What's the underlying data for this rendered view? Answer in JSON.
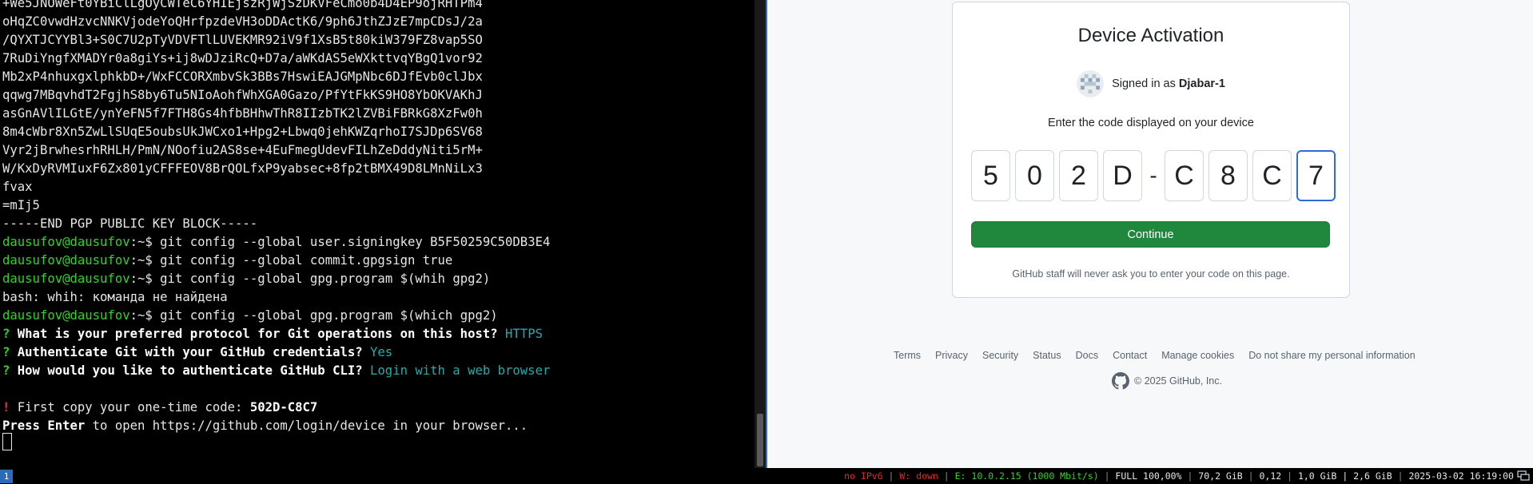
{
  "terminal": {
    "key_lines": [
      "+We5JNOWeFt0YBiClLgOyCWTeC6YHIEjszRjWjSzDKVFeCmo0b4D4EP9ojRHTPm4",
      "oHqZC0vwdHzvcNNKVjodeYoQHrfpzdeVH3oDDActK6/9ph6JthZJzE7mpCDsJ/2a",
      "/QYXTJCYYBl3+S0C7U2pTyVDVFTlLUVEKMR92iV9f1XsB5t80kiW379FZ8vap5SO",
      "7RuDiYngfXMADYr0a8giYs+ij8wDJziRcQ+D7a/aWKdAS5eWXkttvqYBgQ1vor92",
      "Mb2xP4nhuxgxlphkbD+/WxFCCORXmbvSk3BBs7HswiEAJGMpNbc6DJfEvb0clJbx",
      "qqwg7MBqvhdT2FgjhS8by6Tu5NIoAohfWhXGA0Gazo/PfYtFkKS9HO8YbOKVAKhJ",
      "asGnAVlILGtE/ynYeFN5f7FTH8Gs4hfbBHhwThR8IIzbTK2lZVBiFBRkG8XzFw0h",
      "8m4cWbr8Xn5ZwLlSUqE5oubsUkJWCxo1+Hpg2+Lbwq0jehKWZqrhoI7SJDp6SV68",
      "Vyr2jBrwhesrhRHLH/PmN/NOofiu2AS8se+4EuFmegUdevFILhZeDddyNiti5rM+",
      "W/KxDyRVMIuxF6Zx801yCFFFEOV8BrQOLfxP9yabsec+8fp2tBMX49D8LMnNiLx3",
      "fvax",
      "=mIj5",
      "-----END PGP PUBLIC KEY BLOCK-----"
    ],
    "prompt_user": "dausufov@dausufov",
    "prompt_suffix": ":~$ ",
    "cmd1": "git config --global user.signingkey B5F50259C50DB3E4",
    "cmd2": "git config --global commit.gpgsign true",
    "cmd3": "git config --global gpg.program $(whih gpg2)",
    "error_line": "bash: whih: команда не найдена",
    "cmd4": "git config --global gpg.program $(which gpg2)",
    "q_mark": "? ",
    "q1": "What is your preferred protocol for Git operations on this host? ",
    "a1": "HTTPS",
    "q2": "Authenticate Git with your GitHub credentials? ",
    "a2": "Yes",
    "q3": "How would you like to authenticate GitHub CLI? ",
    "a3": "Login with a web browser",
    "bang": "! ",
    "copy_text": "First copy your one-time code: ",
    "one_time_code": "502D-C8C7",
    "press_enter": "Press Enter",
    "open_text": " to open https://github.com/login/device in your browser..."
  },
  "browser": {
    "card_title": "Device Activation",
    "signed_in_prefix": "Signed in as ",
    "username": "Djabar-1",
    "instruction": "Enter the code displayed on your device",
    "code_chars": [
      "5",
      "0",
      "2",
      "D",
      "C",
      "8",
      "C",
      "7"
    ],
    "dash": "-",
    "continue_label": "Continue",
    "staff_notice": "GitHub staff will never ask you to enter your code on this page.",
    "footer_links": [
      "Terms",
      "Privacy",
      "Security",
      "Status",
      "Docs",
      "Contact",
      "Manage cookies",
      "Do not share my personal information"
    ],
    "copyright": "© 2025 GitHub, Inc."
  },
  "status_bar": {
    "workspace": "1",
    "ipv6": "no IPv6",
    "wifi": "W: down",
    "ethernet": "E: 10.0.2.15 (1000 Mbit/s)",
    "battery": "FULL 100,00%",
    "disk": "70,2 GiB",
    "load": "0,12",
    "memory": "1,0 GiB | 2,6 GiB",
    "datetime": "2025-03-02 16:19:00"
  },
  "colors": {
    "accent_green": "#1f883d",
    "prompt_green": "#35d02a",
    "answer_cyan": "#2aa7a7",
    "focus_blue": "#2f6bd9"
  }
}
